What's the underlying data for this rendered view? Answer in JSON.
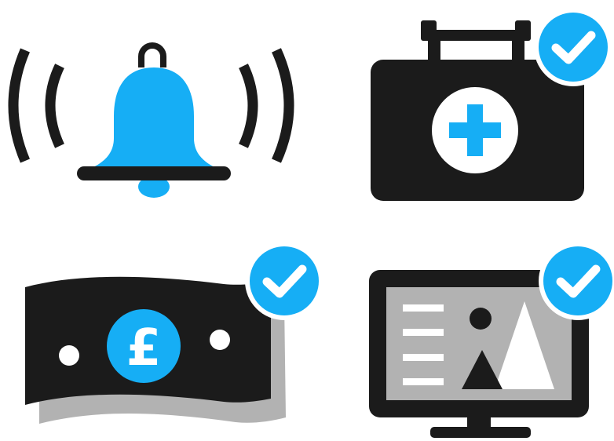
{
  "icons": [
    {
      "name": "alarm-bell-icon",
      "has_check_badge": false
    },
    {
      "name": "first-aid-kit-icon",
      "has_check_badge": true
    },
    {
      "name": "banknote-pound-icon",
      "has_check_badge": true
    },
    {
      "name": "monitor-media-icon",
      "has_check_badge": true
    }
  ],
  "banknote": {
    "currency_symbol": "£"
  },
  "colors": {
    "ink": "#1b1b1b",
    "accent": "#16aef5",
    "grey": "#b2b2b2",
    "background": "#ffffff"
  }
}
